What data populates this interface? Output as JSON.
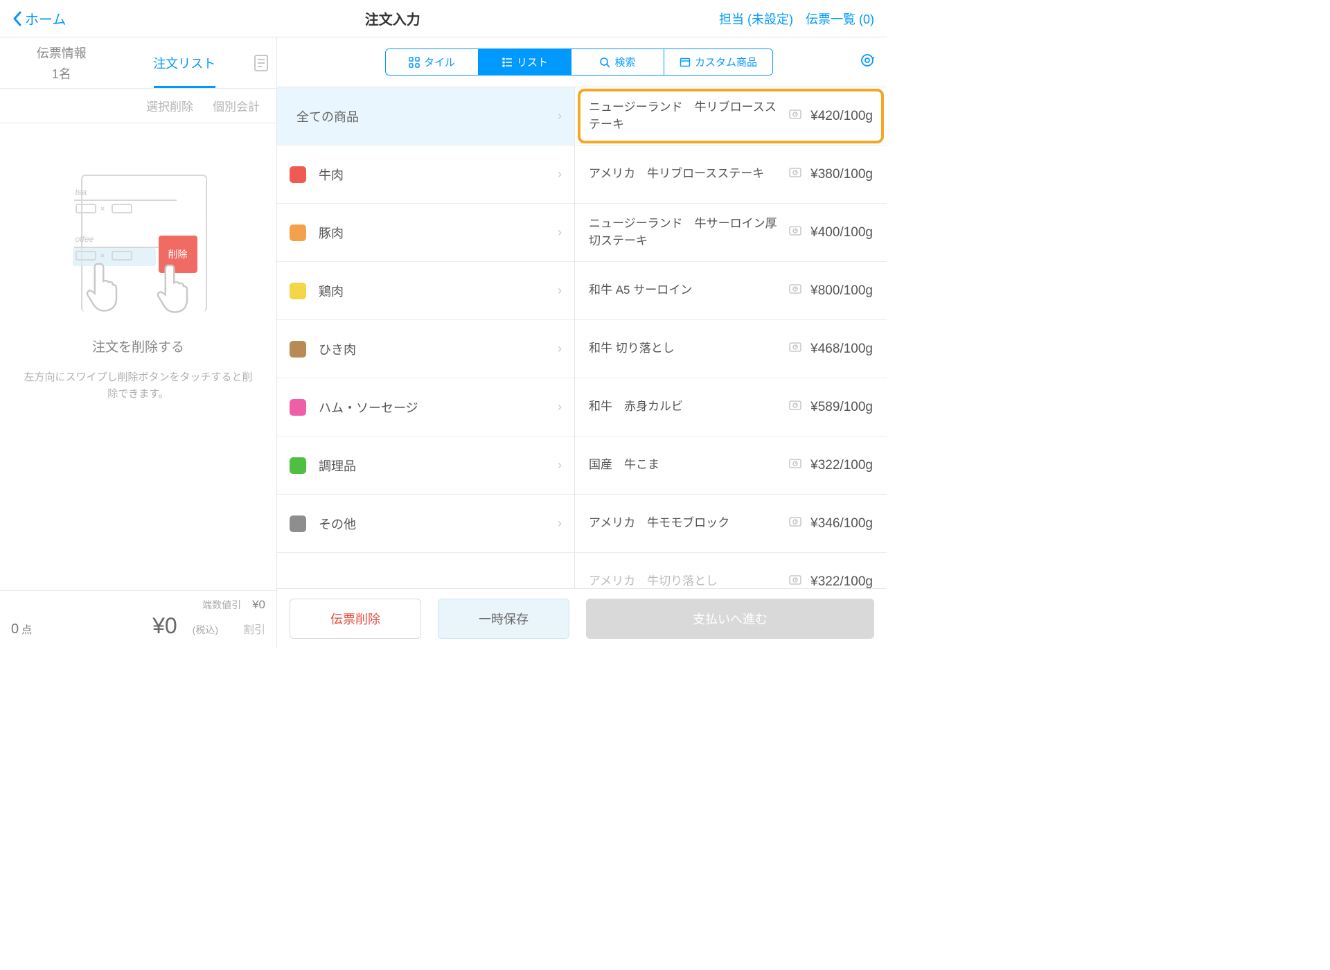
{
  "topbar": {
    "home": "ホーム",
    "title": "注文入力",
    "assignee": "担当 (未設定)",
    "slip_list": "伝票一覧 (0)"
  },
  "left": {
    "tab_info_l1": "伝票情報",
    "tab_info_l2": "1名",
    "tab_order": "注文リスト",
    "action_delete_sel": "選択削除",
    "action_individual": "個別会計",
    "illus_del": "削除",
    "illus_tea": "tea",
    "illus_coffee": "offee",
    "hint_title": "注文を削除する",
    "hint_desc": "左方向にスワイプし削除ボタンをタッチすると削除できます。",
    "footer": {
      "rounding_label": "端数値引",
      "rounding_value": "¥0",
      "count_n": "0",
      "count_unit": "点",
      "total": "¥0",
      "tax": "(税込)",
      "discount": "割引"
    }
  },
  "right": {
    "seg": {
      "tile": "タイル",
      "list": "リスト",
      "search": "検索",
      "custom": "カスタム商品"
    },
    "cat_all": "全ての商品",
    "categories": [
      {
        "label": "牛肉",
        "color": "#ef5b52"
      },
      {
        "label": "豚肉",
        "color": "#f3a14a"
      },
      {
        "label": "鶏肉",
        "color": "#f4d646"
      },
      {
        "label": "ひき肉",
        "color": "#b98a55"
      },
      {
        "label": "ハム・ソーセージ",
        "color": "#ef5fa7"
      },
      {
        "label": "調理品",
        "color": "#4fbf3f"
      },
      {
        "label": "その他",
        "color": "#8e8e8e"
      }
    ],
    "products": [
      {
        "name": "ニュージーランド　牛リブロースステーキ",
        "price": "¥420/100g",
        "hl": true
      },
      {
        "name": "アメリカ　牛リブロースステーキ",
        "price": "¥380/100g"
      },
      {
        "name": "ニュージーランド　牛サーロイン厚切ステーキ",
        "price": "¥400/100g"
      },
      {
        "name": "和牛 A5 サーロイン",
        "price": "¥800/100g"
      },
      {
        "name": "和牛 切り落とし",
        "price": "¥468/100g"
      },
      {
        "name": "和牛　赤身カルビ",
        "price": "¥589/100g"
      },
      {
        "name": "国産　牛こま",
        "price": "¥322/100g"
      },
      {
        "name": "アメリカ　牛モモブロック",
        "price": "¥346/100g"
      },
      {
        "name": "アメリカ　牛切り落とし",
        "price": "¥322/100g",
        "cut": true
      }
    ],
    "footer": {
      "delete": "伝票削除",
      "save": "一時保存",
      "pay": "支払いへ進む"
    }
  }
}
